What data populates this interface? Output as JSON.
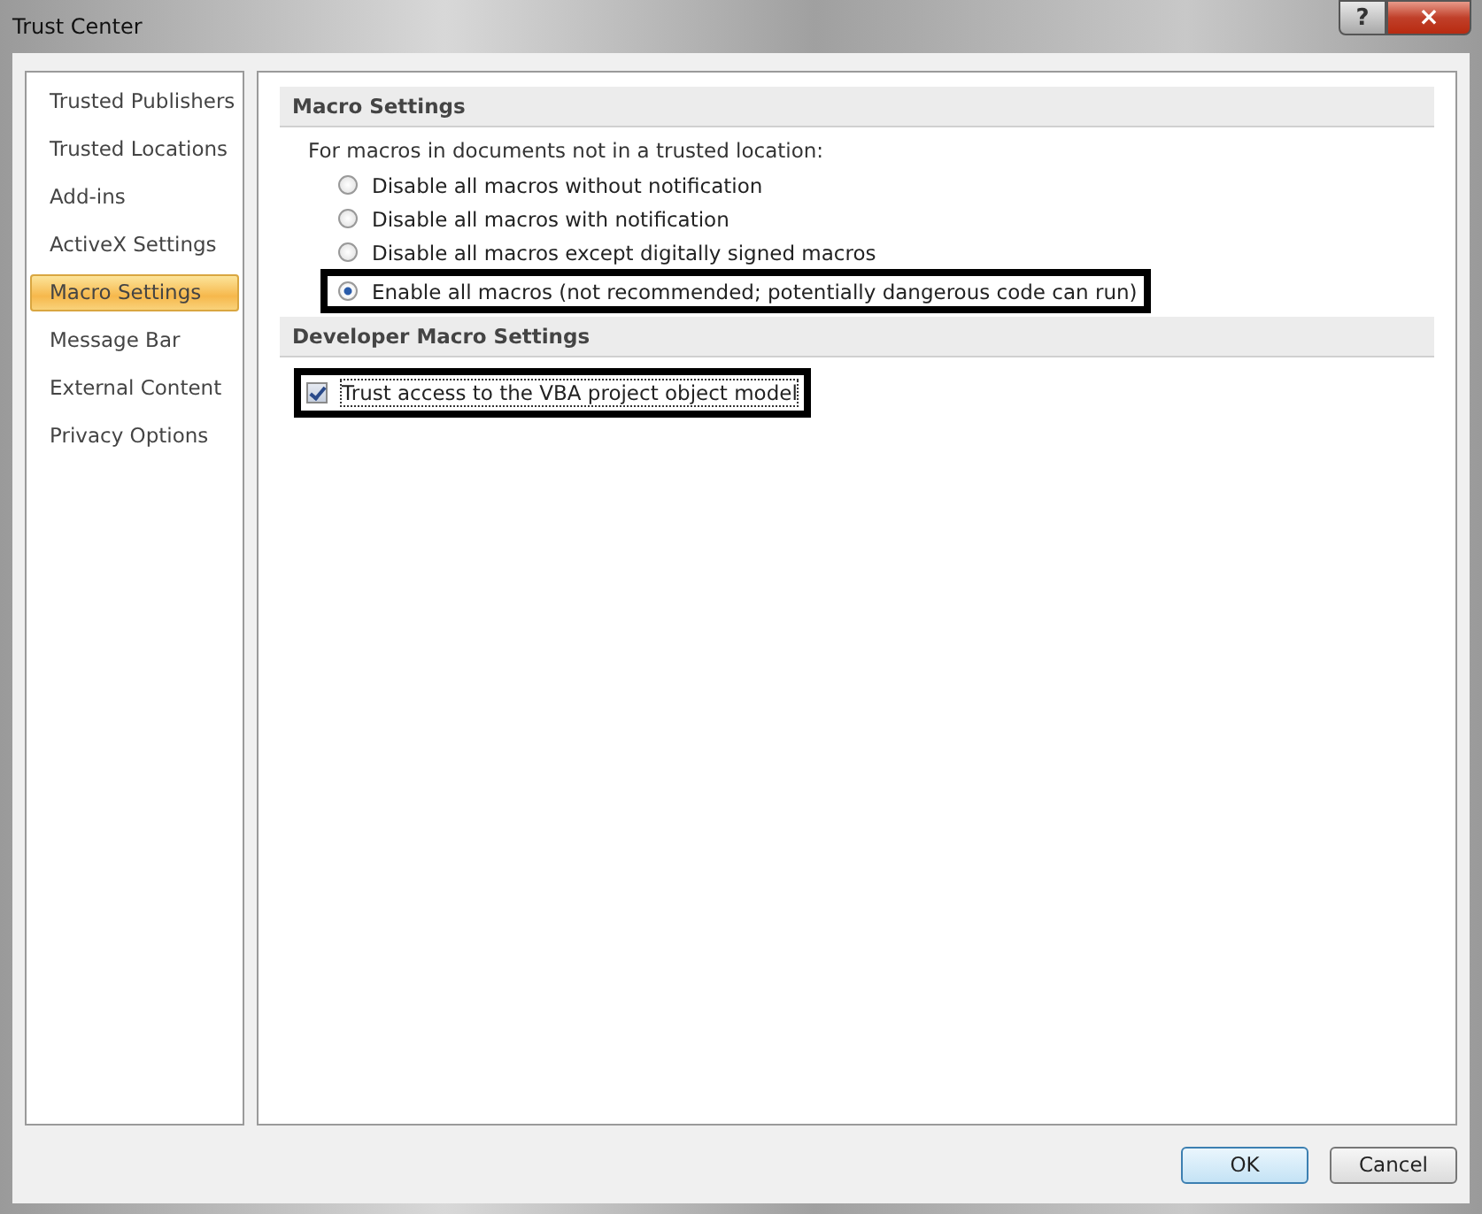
{
  "window": {
    "title": "Trust Center",
    "help_button": "?",
    "close_button": "×"
  },
  "sidebar": {
    "items": [
      {
        "label": "Trusted Publishers",
        "selected": false
      },
      {
        "label": "Trusted Locations",
        "selected": false
      },
      {
        "label": "Add-ins",
        "selected": false
      },
      {
        "label": "ActiveX Settings",
        "selected": false
      },
      {
        "label": "Macro Settings",
        "selected": true
      },
      {
        "label": "Message Bar",
        "selected": false
      },
      {
        "label": "External Content",
        "selected": false
      },
      {
        "label": "Privacy Options",
        "selected": false
      }
    ]
  },
  "sections": [
    {
      "heading": "Macro Settings",
      "intro": "For macros in documents not in a trusted location:",
      "options": [
        {
          "kind": "radio",
          "label": "Disable all macros without notification",
          "selected": false,
          "highlighted": false
        },
        {
          "kind": "radio",
          "label": "Disable all macros with notification",
          "selected": false,
          "highlighted": false
        },
        {
          "kind": "radio",
          "label": "Disable all macros except digitally signed macros",
          "selected": false,
          "highlighted": false
        },
        {
          "kind": "radio",
          "label": "Enable all macros (not recommended; potentially dangerous code can run)",
          "selected": true,
          "highlighted": true
        }
      ]
    },
    {
      "heading": "Developer Macro Settings",
      "options": [
        {
          "kind": "checkbox",
          "label": "Trust access to the VBA project object model",
          "checked": true,
          "highlighted": true
        }
      ]
    }
  ],
  "buttons": [
    {
      "label": "OK",
      "default": true
    },
    {
      "label": "Cancel",
      "default": false
    }
  ]
}
